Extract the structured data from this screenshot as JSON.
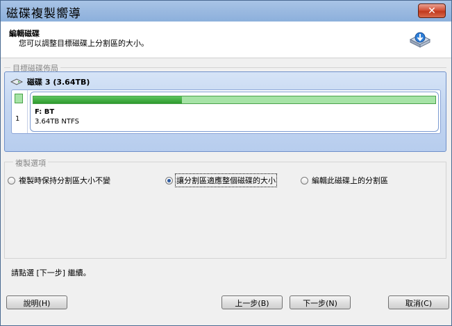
{
  "window": {
    "title": "磁碟複製嚮導",
    "close_label": "✕"
  },
  "header": {
    "title": "編輯磁碟",
    "subtitle": "您可以調整目標磁碟上分割區的大小。"
  },
  "disk_group": {
    "label": "目標磁碟佈局",
    "disk_name": "磁碟 3 (3.64TB)",
    "index": "1",
    "partition": {
      "name": "F: BT",
      "info": "3.64TB NTFS",
      "used_fraction": 0.37
    }
  },
  "options_group": {
    "label": "複製選項",
    "options": [
      {
        "label": "複製時保持分割區大小不變",
        "selected": false
      },
      {
        "label": "讓分割區適應整個磁碟的大小",
        "selected": true
      },
      {
        "label": "編輯此磁碟上的分割區",
        "selected": false
      }
    ]
  },
  "status_text": "請點選 [下一步] 繼續。",
  "buttons": {
    "help": "說明(H)",
    "back": "上一步(B)",
    "next": "下一步(N)",
    "cancel": "取消(C)"
  },
  "colors": {
    "titlebar": "#9ab9e0",
    "panel": "#c5d7f1",
    "bar_fill": "#2e9a2e",
    "bar_bg": "#a6e3a6",
    "close": "#c0391d"
  }
}
